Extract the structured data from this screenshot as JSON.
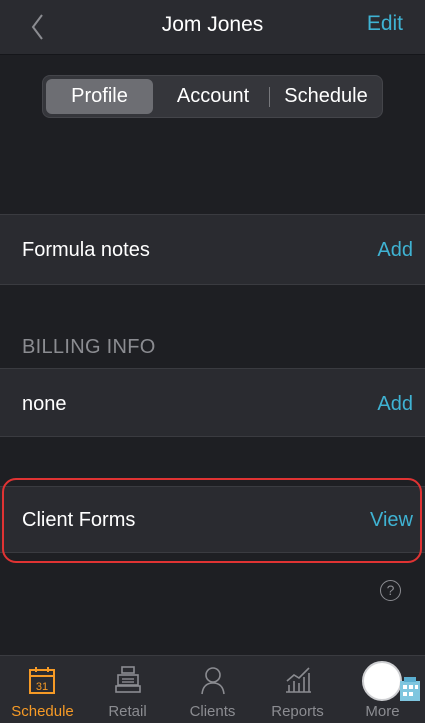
{
  "header": {
    "title": "Jom Jones",
    "edit_label": "Edit"
  },
  "segments": {
    "profile": "Profile",
    "account": "Account",
    "schedule": "Schedule",
    "selected": "Profile"
  },
  "formula_notes": {
    "label": "Formula notes",
    "action": "Add"
  },
  "billing": {
    "section_title": "BILLING INFO",
    "value": "none",
    "action": "Add"
  },
  "client_forms": {
    "label": "Client Forms",
    "action": "View"
  },
  "help": {
    "glyph": "?"
  },
  "tabbar": {
    "schedule": {
      "label": "Schedule",
      "day": "31",
      "icon": "calendar-icon"
    },
    "retail": {
      "label": "Retail",
      "icon": "cash-register-icon"
    },
    "clients": {
      "label": "Clients",
      "icon": "person-icon"
    },
    "reports": {
      "label": "Reports",
      "icon": "chart-icon"
    },
    "more": {
      "label": "More",
      "icon": "building-avatar-icon"
    }
  },
  "colors": {
    "accent": "#3fb3d3",
    "active_tab": "#f59a26",
    "highlight": "#e03333",
    "background": "#1e1f23"
  }
}
